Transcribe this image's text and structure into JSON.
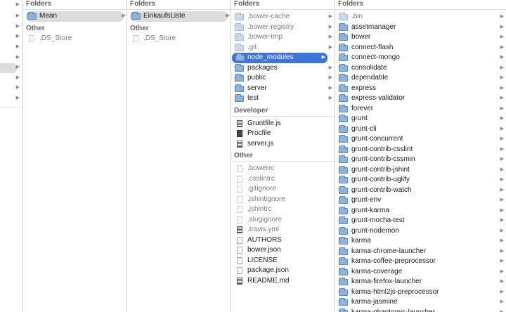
{
  "labels": {
    "folders": "Folders",
    "other": "Other",
    "developer": "Developer"
  },
  "col1": {
    "folders": [
      {
        "name": "Mean",
        "selected": true
      }
    ],
    "other": [
      ".DS_Store"
    ]
  },
  "col2": {
    "folders": [
      {
        "name": "EinkaufsListe",
        "selected": true
      }
    ],
    "other": [
      ".DS_Store"
    ]
  },
  "col3": {
    "folders": [
      {
        "name": ".bower-cache",
        "dim": true
      },
      {
        "name": ".bower-registry",
        "dim": true
      },
      {
        "name": ".bower-tmp",
        "dim": true
      },
      {
        "name": ".git",
        "dim": true
      },
      {
        "name": "node_modules",
        "selected": true
      },
      {
        "name": "packages"
      },
      {
        "name": "public"
      },
      {
        "name": "server"
      },
      {
        "name": "test"
      }
    ],
    "developer": [
      {
        "name": "Gruntfile.js",
        "icon": "script-file-icon"
      },
      {
        "name": "Procfile",
        "icon": "binary-file-icon"
      },
      {
        "name": "server.js",
        "icon": "script-file-icon"
      }
    ],
    "other": [
      {
        "name": ".bowerrc",
        "dim": true
      },
      {
        "name": ".csslintrc",
        "dim": true
      },
      {
        "name": ".gitignore",
        "dim": true
      },
      {
        "name": ".jshintignore",
        "dim": true
      },
      {
        "name": ".jshintrc",
        "dim": true
      },
      {
        "name": ".slugignore",
        "dim": true
      },
      {
        "name": ".travis.yml",
        "dim": true,
        "icon": "script-file-icon"
      },
      {
        "name": "AUTHORS"
      },
      {
        "name": "bower.json"
      },
      {
        "name": "LICENSE"
      },
      {
        "name": "package.json"
      },
      {
        "name": "README.md",
        "icon": "script-file-icon"
      }
    ]
  },
  "col4": {
    "folders": [
      {
        "name": ".bin",
        "dim": true
      },
      {
        "name": "assetmanager"
      },
      {
        "name": "bower"
      },
      {
        "name": "connect-flash"
      },
      {
        "name": "connect-mongo"
      },
      {
        "name": "consolidate"
      },
      {
        "name": "dependable"
      },
      {
        "name": "express"
      },
      {
        "name": "express-validator"
      },
      {
        "name": "forever"
      },
      {
        "name": "grunt"
      },
      {
        "name": "grunt-cli"
      },
      {
        "name": "grunt-concurrent"
      },
      {
        "name": "grunt-contrib-csslint"
      },
      {
        "name": "grunt-contrib-cssmin"
      },
      {
        "name": "grunt-contrib-jshint"
      },
      {
        "name": "grunt-contrib-uglify"
      },
      {
        "name": "grunt-contrib-watch"
      },
      {
        "name": "grunt-env"
      },
      {
        "name": "grunt-karma"
      },
      {
        "name": "grunt-mocha-test"
      },
      {
        "name": "grunt-nodemon"
      },
      {
        "name": "karma"
      },
      {
        "name": "karma-chrome-launcher"
      },
      {
        "name": "karma-coffee-preprocessor"
      },
      {
        "name": "karma-coverage"
      },
      {
        "name": "karma-firefox-launcher"
      },
      {
        "name": "karma-html2js-preprocessor"
      },
      {
        "name": "karma-jasmine"
      },
      {
        "name": "karma-phantomjs-launcher"
      }
    ]
  },
  "colors": {
    "selection": "#3e75d8",
    "inactive_selection": "#dcdcdc",
    "folder": "#8eb4dc"
  }
}
